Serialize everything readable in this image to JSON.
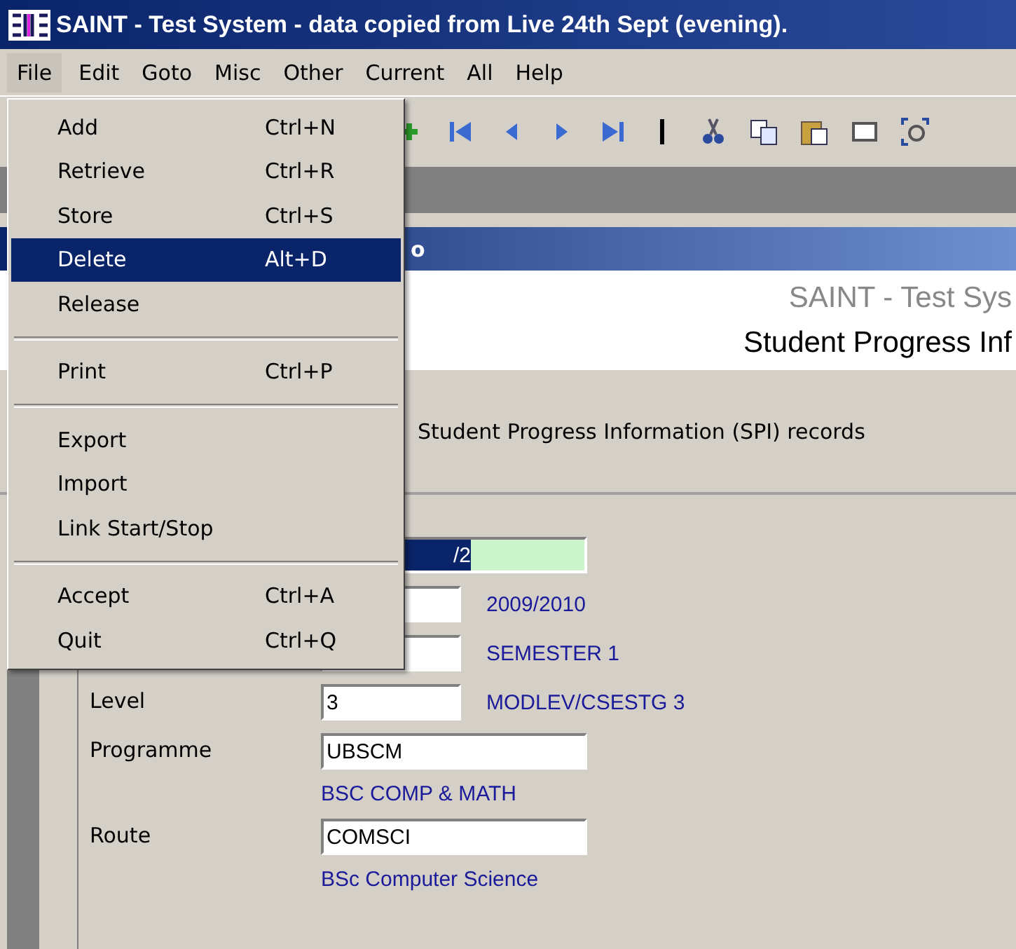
{
  "window": {
    "title": "SAINT - Test System - data copied from Live 24th Sept (evening)."
  },
  "menu_bar": [
    {
      "label": "File",
      "selected": true
    },
    {
      "label": "Edit",
      "selected": false
    },
    {
      "label": "Goto",
      "selected": false
    },
    {
      "label": "Misc",
      "selected": false
    },
    {
      "label": "Other",
      "selected": false
    },
    {
      "label": "Current",
      "selected": false
    },
    {
      "label": "All",
      "selected": false
    },
    {
      "label": "Help",
      "selected": false
    }
  ],
  "file_menu": [
    {
      "kind": "item",
      "label": "Add",
      "shortcut": "Ctrl+N",
      "selected": false
    },
    {
      "kind": "item",
      "label": "Retrieve",
      "shortcut": "Ctrl+R",
      "selected": false
    },
    {
      "kind": "item",
      "label": "Store",
      "shortcut": "Ctrl+S",
      "selected": false
    },
    {
      "kind": "item",
      "label": "Delete",
      "shortcut": "Alt+D",
      "selected": true
    },
    {
      "kind": "item",
      "label": "Release",
      "selected": false
    },
    {
      "kind": "separator"
    },
    {
      "kind": "item",
      "label": "Print",
      "shortcut": "Ctrl+P",
      "selected": false
    },
    {
      "kind": "separator"
    },
    {
      "kind": "item",
      "label": "Export",
      "selected": false
    },
    {
      "kind": "item",
      "label": "Import",
      "selected": false
    },
    {
      "kind": "item",
      "label": "Link Start/Stop",
      "selected": false
    },
    {
      "kind": "separator"
    },
    {
      "kind": "item",
      "label": "Accept",
      "shortcut": "Ctrl+A",
      "selected": false
    },
    {
      "kind": "item",
      "label": "Quit",
      "shortcut": "Ctrl+Q",
      "selected": false
    }
  ],
  "form_window": {
    "title": "o",
    "system_name": "SAINT - Test Sys",
    "form_name": "Student Progress Inf",
    "description": "Student Progress Information (SPI) records"
  },
  "fields": [
    {
      "value": "/2",
      "focused": true
    },
    {
      "description": "2009/2010",
      "focused": false
    },
    {
      "description": "SEMESTER 1",
      "focused": false
    },
    {
      "label": "Level",
      "value": "3",
      "description": "MODLEV/CSESTG 3",
      "focused": false
    },
    {
      "label": "Programme",
      "value": "UBSCM",
      "description": "BSC COMP & MATH",
      "focused": false
    },
    {
      "label": "Route",
      "value": "COMSCI",
      "description": "BSc Computer Science",
      "focused": false
    }
  ]
}
